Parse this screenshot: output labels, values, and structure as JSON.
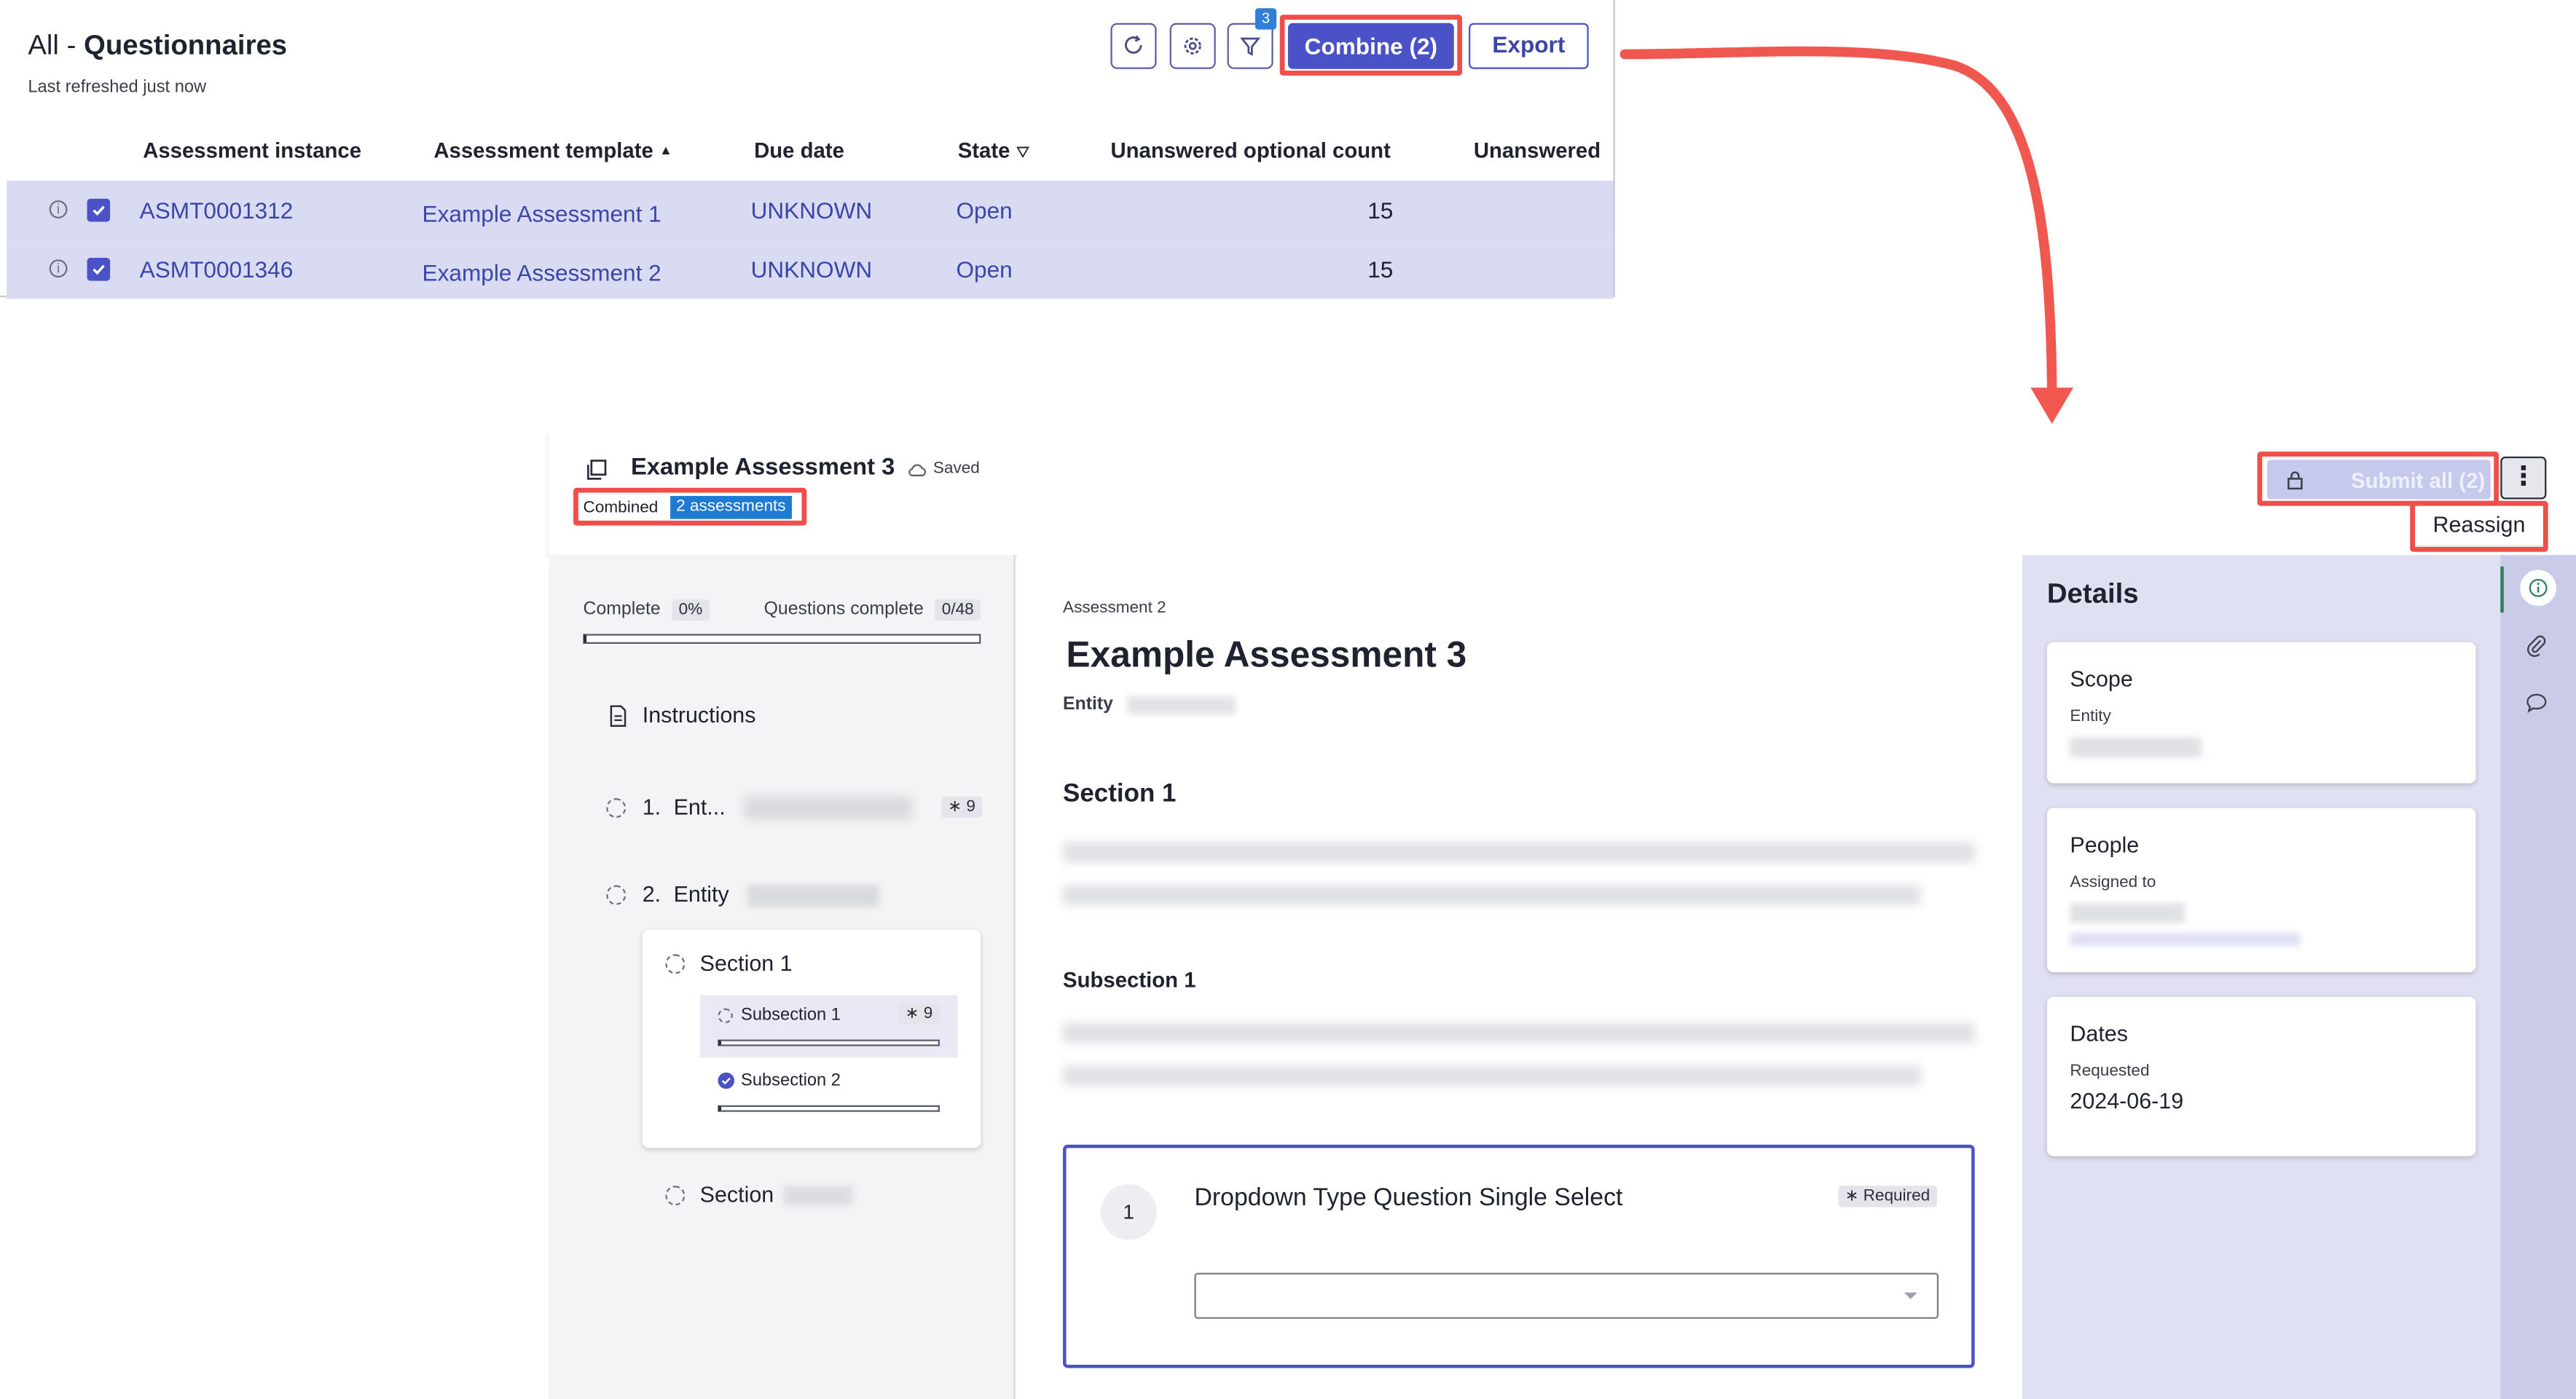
{
  "list": {
    "title_prefix": "All",
    "title_sep": " - ",
    "title": "Questionnaires",
    "subtitle": "Last refreshed just now",
    "filter_count": "3",
    "combine_label": "Combine (2)",
    "export_label": "Export",
    "columns": [
      "Assessment instance",
      "Assessment template",
      "Due date",
      "State",
      "Unanswered optional count",
      "Unanswered"
    ],
    "sort_glyph": "▲",
    "filter_glyph": "⛛",
    "rows": [
      {
        "instance": "ASMT0001312",
        "template": "Example Assessment 1",
        "due": "UNKNOWN",
        "state": "Open",
        "optional": "15"
      },
      {
        "instance": "ASMT0001346",
        "template": "Example Assessment 2",
        "due": "UNKNOWN",
        "state": "Open",
        "optional": "15"
      }
    ]
  },
  "detail": {
    "title": "Example Assessment 3",
    "saved": "Saved",
    "combined_label": "Combined",
    "combined_count": "2 assessments",
    "submit_label": "Submit all (2)",
    "reassign_label": "Reassign",
    "more_glyph": "⋮",
    "progress": {
      "complete_label": "Complete",
      "complete_value": "0%",
      "questions_label": "Questions complete",
      "questions_value": "0/48",
      "complete_fraction": 0
    },
    "nav": {
      "instructions": "Instructions",
      "item1_num": "1.",
      "item1_label": "Ent...",
      "item1_badge": "∗ 9",
      "item2_num": "2.",
      "item2_label": "Entity",
      "section1": "Section 1",
      "subsection1": "Subsection 1",
      "subsection1_badge": "∗ 9",
      "subsection2": "Subsection 2",
      "section_other": "Section"
    },
    "main": {
      "crumb": "Assessment 2",
      "heading": "Example Assessment 3",
      "entity_label": "Entity",
      "section_heading": "Section 1",
      "subsection_heading": "Subsection 1",
      "question_number": "1",
      "question_text": "Dropdown Type Question Single Select",
      "required_label": "∗ Required"
    },
    "sidebar": {
      "title": "Details",
      "scope_title": "Scope",
      "scope_label": "Entity",
      "people_title": "People",
      "people_label": "Assigned to",
      "dates_title": "Dates",
      "dates_label": "Requested",
      "dates_value": "2024-06-19"
    }
  },
  "colors": {
    "accent": "#4a52c7",
    "highlight": "#ef4e4a",
    "selected_row": "#d9dbf2",
    "badge_blue": "#1f7ad1",
    "details_bg": "#dfe0f1"
  }
}
